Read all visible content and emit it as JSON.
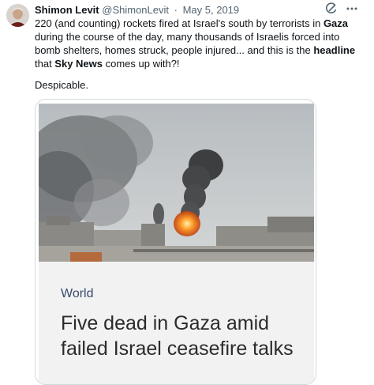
{
  "tweet": {
    "author_name": "Shimon Levit",
    "handle": "@ShimonLevit",
    "separator": "·",
    "date": "May 5, 2019",
    "text_parts": [
      "220 (and counting) rockets fired at Israel's south by terrorists in ",
      "Gaza",
      " during the course of the day, many thousands of Israelis forced into bomb shelters, homes struck, people injured... and this is the ",
      "headline",
      " that ",
      "Sky News",
      " comes up with?!"
    ],
    "text_second": "Despicable.",
    "icons": [
      "grok-icon",
      "more-icon"
    ]
  },
  "card": {
    "section": "World",
    "headline": "Five dead in Gaza amid failed Israel ceasefire talks"
  }
}
